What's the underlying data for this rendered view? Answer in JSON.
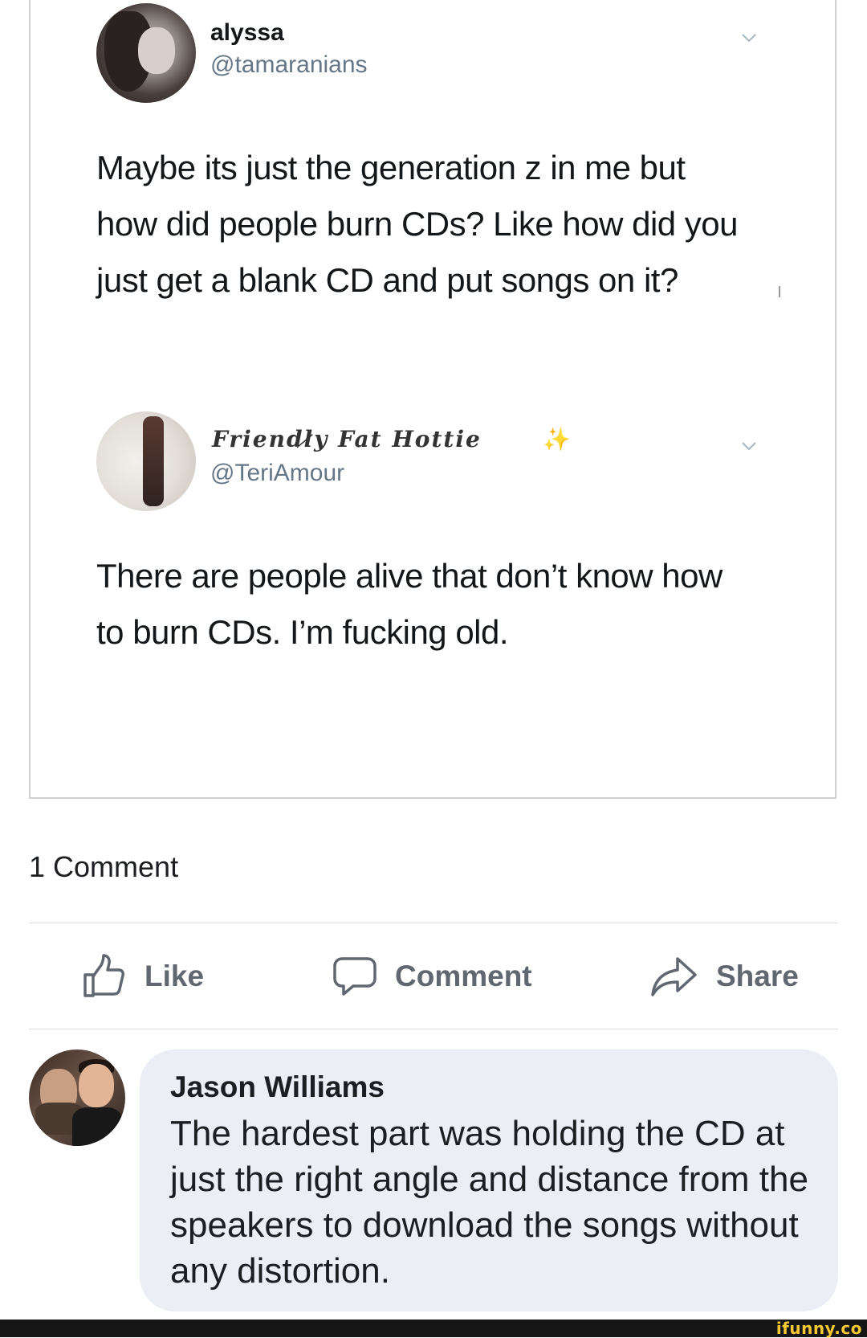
{
  "tweet_1": {
    "display_name": "alyssa",
    "handle": "@tamaranians",
    "text": "Maybe its just the generation z in me but how did people burn CDs? Like how did you just get a blank CD and put songs on it?"
  },
  "tweet_2": {
    "display_name": "Friendl̷y Fat Hottie",
    "handle": "@TeriAmour",
    "text": "There are people alive that don’t know how to burn CDs. I’m fucking old."
  },
  "post": {
    "comment_count_label": "1 Comment",
    "actions": {
      "like_label": "Like",
      "comment_label": "Comment",
      "share_label": "Share"
    }
  },
  "comments": [
    {
      "author": "Jason Williams",
      "text": "The hardest part was holding the CD at just the right angle and distance from the speakers to download the songs without any distortion."
    }
  ],
  "watermark": {
    "text": "ifunny.co"
  },
  "colors": {
    "action_gray": "#606770",
    "bubble_bg": "#ebeef5",
    "handle_gray": "#657786",
    "watermark_yellow": "#f6c933"
  }
}
